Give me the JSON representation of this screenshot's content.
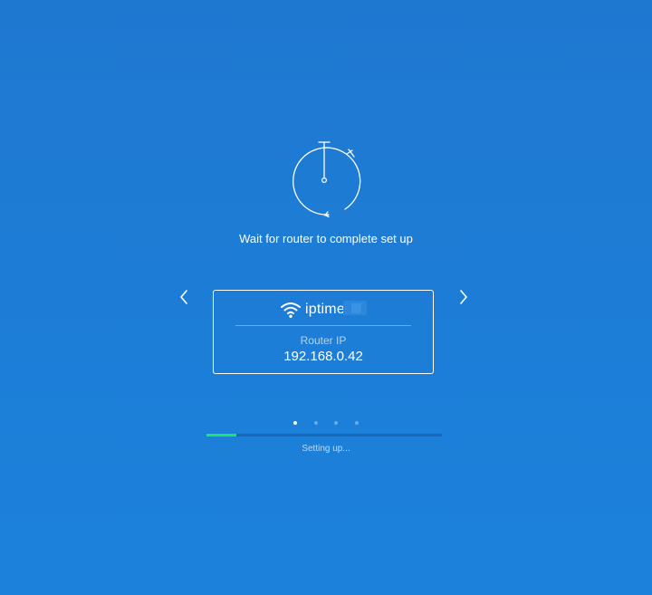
{
  "setup": {
    "headline": "Wait for router to complete set up",
    "status": "Setting up...",
    "progress": 0.125
  },
  "router_card": {
    "brand": "iptime",
    "ip_label": "Router IP",
    "ip_value": "192.168.0.42"
  },
  "carousel": {
    "dot_count": 4,
    "active_index": 0
  },
  "icons": {
    "timer": "stopwatch-icon",
    "prev": "chevron-left-icon",
    "next": "chevron-right-icon",
    "wifi": "wifi-icon"
  },
  "colors": {
    "background": "#1f7bd5",
    "progress_fill": "#1ee36a",
    "foreground": "#ffffff"
  }
}
